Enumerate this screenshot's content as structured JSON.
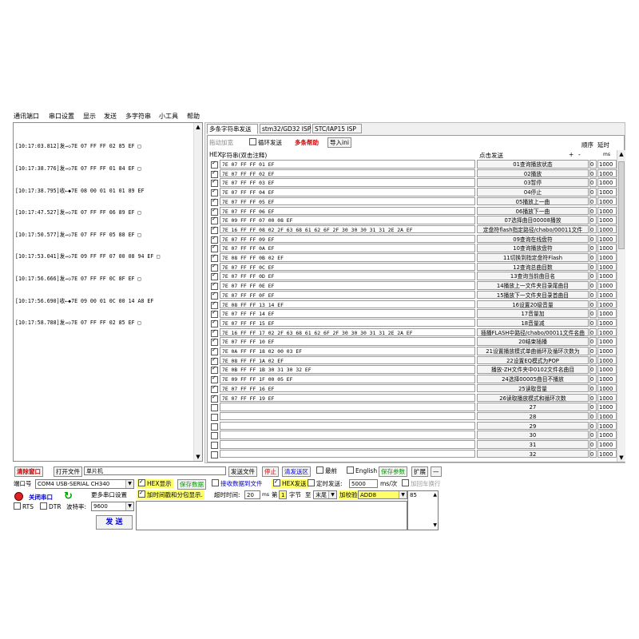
{
  "menu": [
    "通讯端口",
    "串口设置",
    "显示",
    "发送",
    "多字符串",
    "小工具",
    "帮助"
  ],
  "receive": {
    "lines": [
      "[10:17:03.812]发→◇7E 07 FF FF 02 85 EF □",
      "[10:17:38.776]发→◇7E 07 FF FF 01 84 EF □",
      "[10:17:38.795]收←◆7E 08 00 01 01 01 89 EF",
      "[10:17:47.527]发→◇7E 07 FF FF 06 89 EF □",
      "[10:17:50.577]发→◇7E 07 FF FF 05 88 EF □",
      "[10:17:53.041]发→◇7E 09 FF FF 07 00 08 94 EF □",
      "[10:17:56.666]发→◇7E 07 FF FF 0C 8F EF □",
      "[10:17:56.690]收←◆7E 09 00 01 0C 00 14 A8 EF",
      "[10:17:58.788]发→◇7E 07 FF FF 02 85 EF □"
    ]
  },
  "tabs": [
    "多条字符串发送",
    "stm32/GD32 ISP",
    "STC/IAP15 ISP"
  ],
  "toolbar": {
    "insert": "拖动加宽",
    "loop": "循环发送",
    "help": "多条帮助",
    "import": "导入ini"
  },
  "headers": {
    "hex": "HEX",
    "string": "字符串(双击注释)",
    "click_send": "点击发送",
    "plus": "+",
    "minus": "-",
    "order": "顺序",
    "delay": "延时",
    "ms": "ms"
  },
  "rows": [
    {
      "checked": true,
      "data": "7E 07 FF FF 01 EF",
      "label": "01查询播放状态",
      "order": "0",
      "delay": "1000"
    },
    {
      "checked": true,
      "data": "7E 07 FF FF 02 EF",
      "label": "02播放",
      "order": "0",
      "delay": "1000"
    },
    {
      "checked": true,
      "data": "7E 07 FF FF 03 EF",
      "label": "03暂停",
      "order": "0",
      "delay": "1000"
    },
    {
      "checked": true,
      "data": "7E 07 FF FF 04 EF",
      "label": "04停止",
      "order": "0",
      "delay": "1000"
    },
    {
      "checked": true,
      "data": "7E 07 FF FF 05 EF",
      "label": "05播放上一曲",
      "order": "0",
      "delay": "1000"
    },
    {
      "checked": true,
      "data": "7E 07 FF FF 06 EF",
      "label": "06播放下一曲",
      "order": "0",
      "delay": "1000"
    },
    {
      "checked": true,
      "data": "7E 09 FF FF 07 00 08 EF",
      "label": "07选择曲目00008播放",
      "order": "0",
      "delay": "1000"
    },
    {
      "checked": true,
      "data": "7E 16 FF FF 08 02 2F 63 68 61 62 6F 2F 30 30 30 31 31 2E 2A EF",
      "label": "定盘符flash指定路径/chabo/00011文件",
      "order": "0",
      "delay": "1000"
    },
    {
      "checked": true,
      "data": "7E 07 FF FF 09 EF",
      "label": "09查询在线盘符",
      "order": "0",
      "delay": "1000"
    },
    {
      "checked": true,
      "data": "7E 07 FF FF 0A EF",
      "label": "10查询播放盘符",
      "order": "0",
      "delay": "1000"
    },
    {
      "checked": true,
      "data": "7E 08 FF FF 0B 02 EF",
      "label": "11切换到指定盘符Flash",
      "order": "0",
      "delay": "1000"
    },
    {
      "checked": true,
      "data": "7E 07 FF FF 0C EF",
      "label": "12查询总曲目数",
      "order": "0",
      "delay": "1000"
    },
    {
      "checked": true,
      "data": "7E 07 FF FF 0D EF",
      "label": "13查询当前曲目名",
      "order": "0",
      "delay": "1000"
    },
    {
      "checked": true,
      "data": "7E 07 FF FF 0E EF",
      "label": "14播放上一文件夹目录尾曲目",
      "order": "0",
      "delay": "1000"
    },
    {
      "checked": true,
      "data": "7E 07 FF FF 0F EF",
      "label": "15播放下一文件夹目录首曲目",
      "order": "0",
      "delay": "1000"
    },
    {
      "checked": true,
      "data": "7E 08 FF FF 13 14 EF",
      "label": "16设置20级音量",
      "order": "0",
      "delay": "1000"
    },
    {
      "checked": true,
      "data": "7E 07 FF FF 14 EF",
      "label": "17音量加",
      "order": "0",
      "delay": "1000"
    },
    {
      "checked": true,
      "data": "7E 07 FF FF 15 EF",
      "label": "18音量减",
      "order": "0",
      "delay": "1000"
    },
    {
      "checked": true,
      "data": "7E 16 FF FF 17 02 2F 63 68 61 62 6F 2F 30 30 30 31 31 2E 2A EF",
      "label": "插播FLASH中路径/chabo/00011文件名曲",
      "order": "0",
      "delay": "1000"
    },
    {
      "checked": true,
      "data": "7E 07 FF FF 10 EF",
      "label": "20结束插播",
      "order": "0",
      "delay": "1000"
    },
    {
      "checked": true,
      "data": "7E 0A FF FF 18 02 00 03 EF",
      "label": "21设置播放模式单曲循环及循环次数为",
      "order": "0",
      "delay": "1000"
    },
    {
      "checked": true,
      "data": "7E 08 FF FF 1A 02 EF",
      "label": "22设置EQ模式为POP",
      "order": "0",
      "delay": "1000"
    },
    {
      "checked": true,
      "data": "7E 0B FF FF 1B 30 31 30 32 EF",
      "label": "播放-ZH文件夹中0102文件名曲目",
      "order": "0",
      "delay": "1000"
    },
    {
      "checked": true,
      "data": "7E 09 FF FF 1F 00 05 EF",
      "label": "24选择00005曲目不播放",
      "order": "0",
      "delay": "1000"
    },
    {
      "checked": true,
      "data": "7E 07 FF FF 16 EF",
      "label": "25读取音量",
      "order": "0",
      "delay": "1000"
    },
    {
      "checked": true,
      "data": "7E 07 FF FF 19 EF",
      "label": "26读取播放模式和循环次数",
      "order": "0",
      "delay": "1000"
    },
    {
      "checked": false,
      "data": "",
      "label": "27",
      "order": "0",
      "delay": "1000"
    },
    {
      "checked": false,
      "data": "",
      "label": "28",
      "order": "0",
      "delay": "1000"
    },
    {
      "checked": false,
      "data": "",
      "label": "29",
      "order": "0",
      "delay": "1000"
    },
    {
      "checked": false,
      "data": "",
      "label": "30",
      "order": "0",
      "delay": "1000"
    },
    {
      "checked": false,
      "data": "",
      "label": "31",
      "order": "0",
      "delay": "1000"
    },
    {
      "checked": false,
      "data": "",
      "label": "32",
      "order": "0",
      "delay": "1000"
    }
  ],
  "bottom": {
    "clear_window": "清除窗口",
    "open_file": "打开文件",
    "file_value": "单片机",
    "send_file": "发送文件",
    "stop": "停止",
    "clear_send": "清发送区",
    "topmost": "最前",
    "english": "English",
    "save_params": "保存参数",
    "expand": "扩展",
    "collapse": "—",
    "port_label": "端口号",
    "port_value": "COM4 USB-SERIAL CH340",
    "hex_display": "HEX显示",
    "save_data": "保存数据",
    "recv_to_file": "接收数据到文件",
    "hex_send": "HEX发送",
    "timed_send": "定时发送:",
    "timed_value": "5000",
    "timed_unit": "ms/次",
    "add_enter": "加回车换行",
    "close_port": "关闭串口",
    "more_settings": "更多串口设置",
    "timestamp": "加时间戳和分包显示.",
    "timeout_label": "超时时间:",
    "timeout_value": "20",
    "timeout_unit": "ms",
    "nth": "第",
    "byte_from": "1",
    "byte_label": "字节",
    "to": "至",
    "to_value": "末尾",
    "checksum_label": "加校验",
    "checksum_value": "ADD8",
    "send_area_value": "85",
    "rts": "RTS",
    "dtr": "DTR",
    "baud_label": "波特率:",
    "baud_value": "9600",
    "send": "发 送"
  }
}
